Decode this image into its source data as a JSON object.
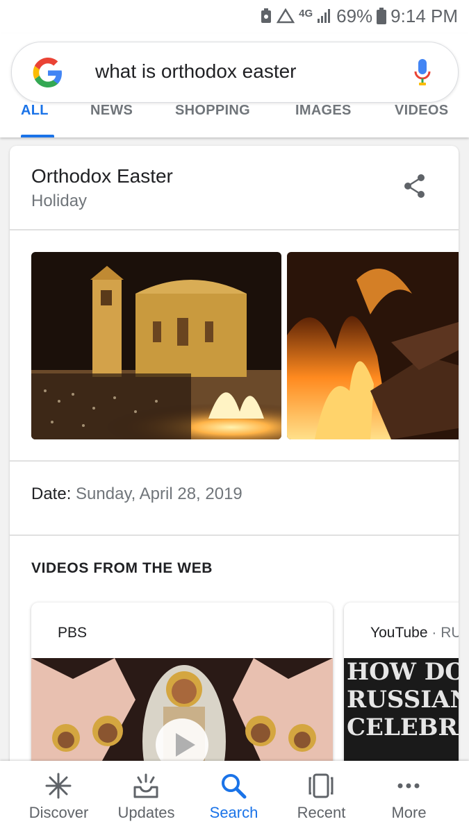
{
  "status_bar": {
    "network": "4G",
    "battery": "69%",
    "time": "9:14 PM"
  },
  "search": {
    "query": "what is orthodox easter"
  },
  "tabs": [
    {
      "label": "ALL",
      "active": true
    },
    {
      "label": "NEWS"
    },
    {
      "label": "SHOPPING"
    },
    {
      "label": "IMAGES"
    },
    {
      "label": "VIDEOS"
    }
  ],
  "entity": {
    "title": "Orthodox Easter",
    "subtitle": "Holiday",
    "date_label": "Date:",
    "date_value": "Sunday, April 28, 2019"
  },
  "videos": {
    "heading": "VIDEOS FROM THE WEB",
    "items": [
      {
        "source": "PBS"
      },
      {
        "source": "YouTube",
        "source_extra": "RUS",
        "thumb_text": [
          "HOW DO",
          "RUSSIANS",
          "CELEBRATE"
        ]
      }
    ]
  },
  "bottom_nav": [
    {
      "label": "Discover",
      "icon": "asterisk-icon"
    },
    {
      "label": "Updates",
      "icon": "updates-tray-icon"
    },
    {
      "label": "Search",
      "icon": "search-icon",
      "active": true
    },
    {
      "label": "Recent",
      "icon": "recent-cards-icon"
    },
    {
      "label": "More",
      "icon": "more-dots-icon"
    }
  ],
  "colors": {
    "accent": "#1a73e8",
    "grey_text": "#70757a"
  }
}
